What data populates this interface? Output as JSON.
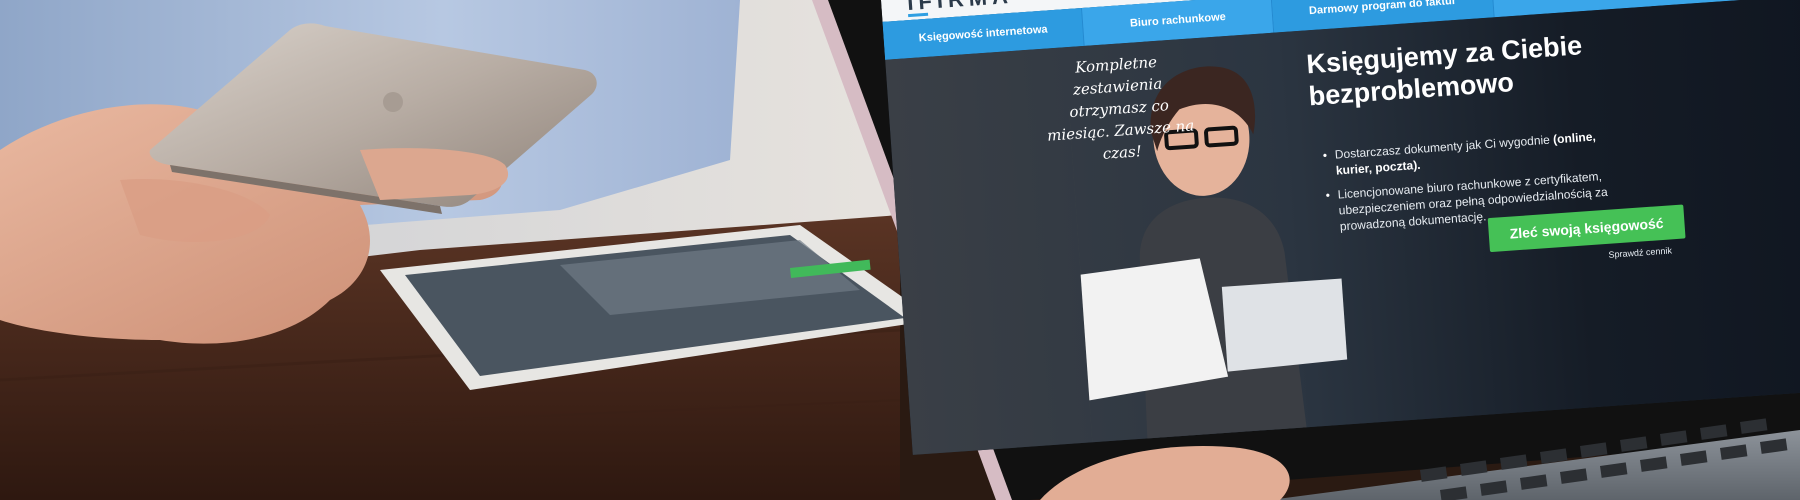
{
  "site": {
    "logo": "IFIRMA",
    "nav": [
      {
        "label": "Księgowość internetowa"
      },
      {
        "label": "Biuro rachunkowe"
      },
      {
        "label": "Darmowy program do faktur"
      }
    ],
    "hero": {
      "headline": "Księgujemy za Ciebie bezproblemowo",
      "handwritten_note": "Kompletne zestawienia otrzymasz co miesiąc. Zawsze na czas!",
      "points": [
        {
          "text": "Dostarczasz dokumenty jak Ci wygodnie",
          "bold": "(online, kurier, poczta)."
        },
        {
          "text": "Licencjonowane biuro rachunkowe z certyfikatem, ubezpieczeniem oraz pełną odpowiedzialnością za prowadzoną dokumentację.",
          "bold": ""
        }
      ],
      "cta_label": "Zleć swoją księgowość",
      "price_link": "Sprawdź cennik"
    }
  },
  "colors": {
    "nav_blue": "#2d9be0",
    "cta_green": "#45c156",
    "table_wood": "#4a2a1e",
    "shirt_blue": "#a9bfdc"
  }
}
